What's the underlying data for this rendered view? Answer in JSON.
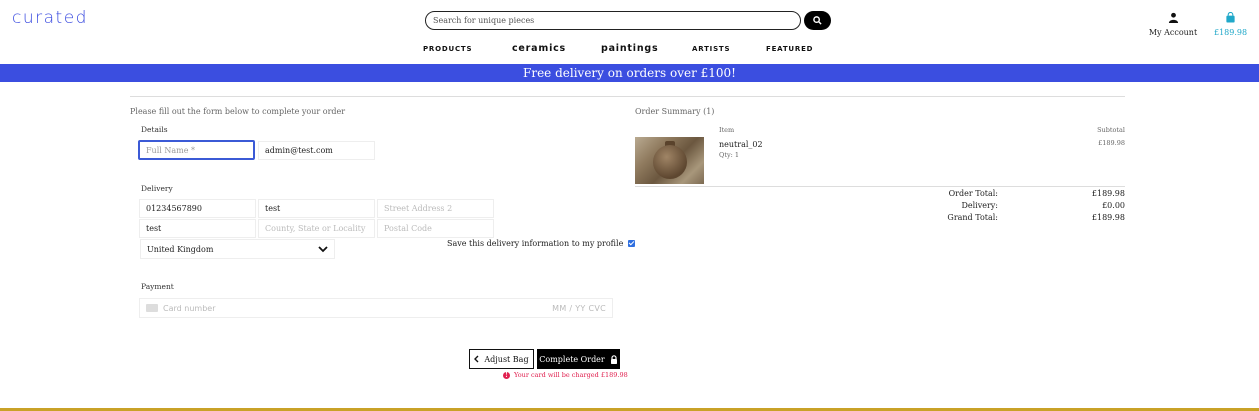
{
  "header": {
    "logo": "curated",
    "search_placeholder": "Search for unique pieces",
    "account_label": "My Account",
    "bag_total": "£189.98"
  },
  "nav": {
    "items": [
      "products",
      "ceramics",
      "paintings",
      "artists",
      "featured"
    ]
  },
  "banner": {
    "text": "Free delivery on orders over £100!"
  },
  "form": {
    "intro": "Please fill out the form below to complete your order",
    "details_label": "Details",
    "full_name_placeholder": "Full Name *",
    "email_value": "admin@test.com",
    "delivery_label": "Delivery",
    "phone_value": "01234567890",
    "street1_value": "test",
    "street2_placeholder": "Street Address 2",
    "town_value": "test",
    "county_placeholder": "County, State or Locality",
    "postcode_placeholder": "Postal Code",
    "country_value": "United Kingdom",
    "save_label": "Save this delivery information to my profile",
    "payment_label": "Payment",
    "card_placeholder": "Card number",
    "card_expiry_cvc": "MM / YY  CVC",
    "adjust_label": "Adjust Bag",
    "complete_label": "Complete Order",
    "charge_notice": "Your card will be charged £189.98"
  },
  "summary": {
    "title": "Order Summary (1)",
    "col_item": "Item",
    "col_subtotal": "Subtotal",
    "item_name": "neutral_02",
    "item_qty": "Qty: 1",
    "item_subtotal": "£189.98",
    "order_total_label": "Order Total:",
    "order_total": "£189.98",
    "delivery_label": "Delivery:",
    "delivery": "£0.00",
    "grand_total_label": "Grand Total:",
    "grand_total": "£189.98"
  },
  "colors": {
    "brand": "#3b4ee0",
    "bag": "#20a8c9",
    "error": "#e0204f",
    "footer_line": "#c9a227"
  }
}
